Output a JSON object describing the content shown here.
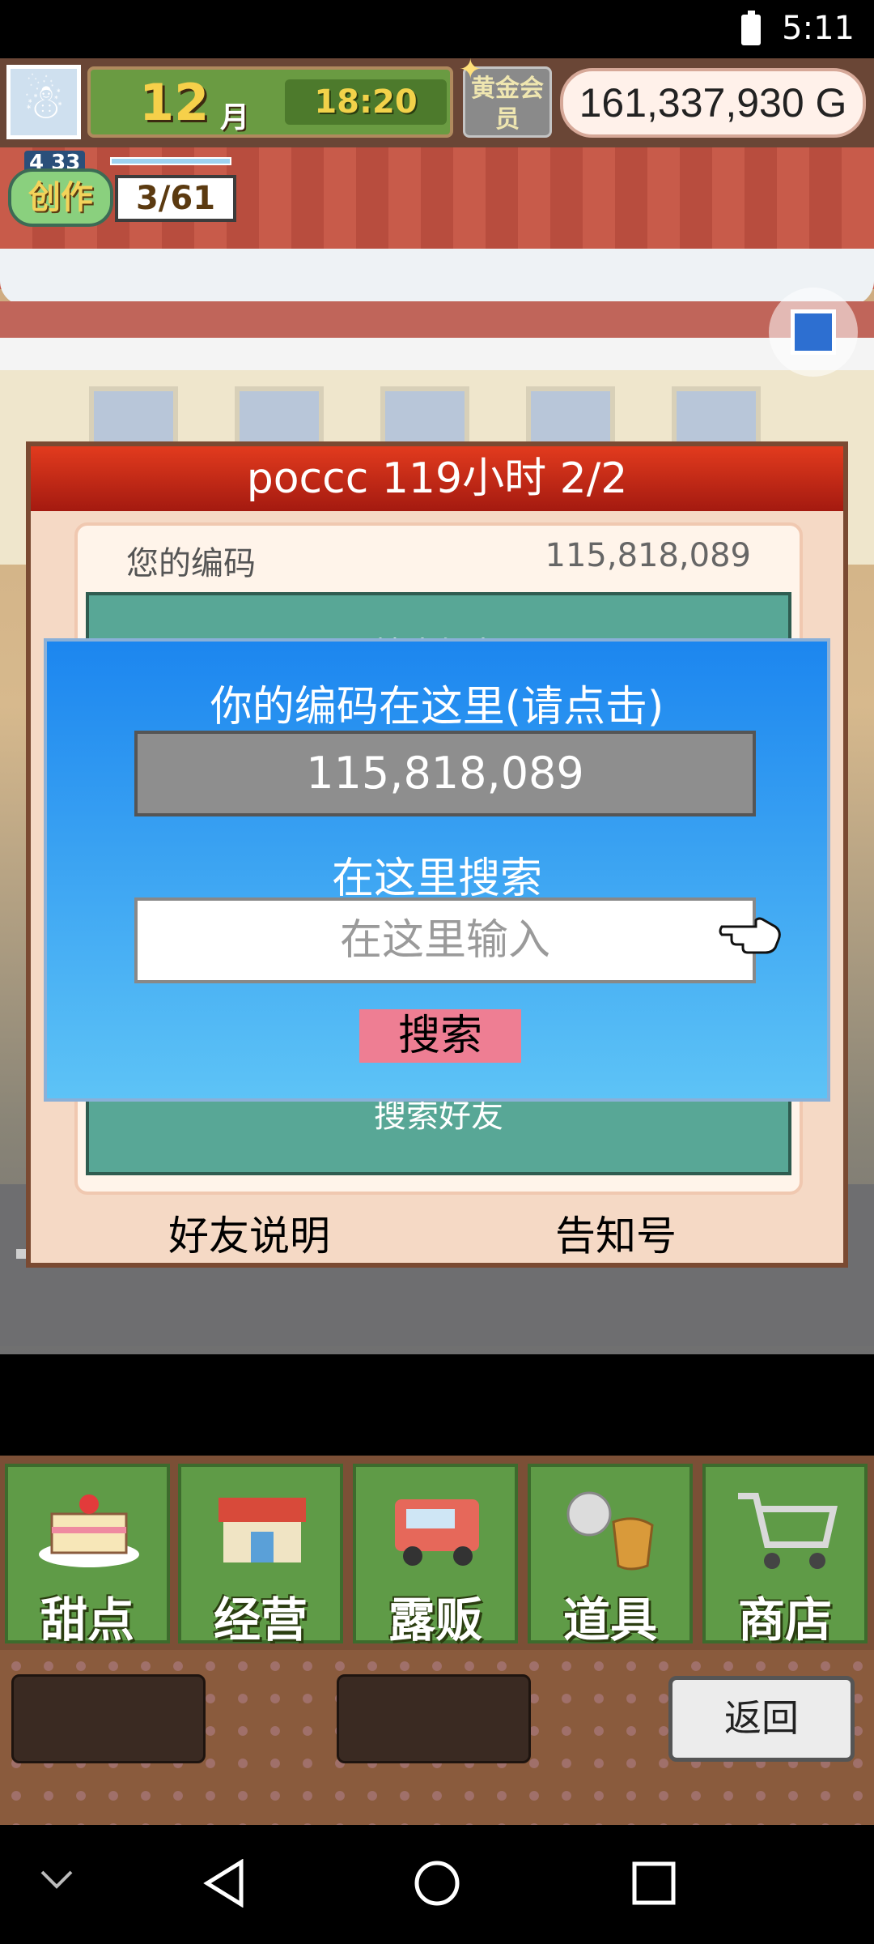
{
  "status_bar": {
    "time": "5:11"
  },
  "hud": {
    "month_number": "12",
    "month_unit": "月",
    "time": "18:20",
    "member_badge": "黄金会员",
    "money": "161,337,930 G"
  },
  "creation": {
    "level": "4 33",
    "label": "创作",
    "count": "3/61"
  },
  "friend_panel": {
    "title": "poccc  119小时 2/2",
    "code_label": "您的编码",
    "code_value": "115,818,089",
    "top_button": "搜索好友",
    "bottom_button": "搜索好友",
    "footer_left": "好友说明",
    "footer_right": "告知号"
  },
  "search_dialog": {
    "title": "你的编码在这里(请点击)",
    "code": "115,818,089",
    "subtitle": "在这里搜索",
    "input_placeholder": "在这里输入",
    "search_button": "搜索"
  },
  "menu": {
    "items": [
      {
        "label": "甜点",
        "icon": "cake-icon"
      },
      {
        "label": "经营",
        "icon": "shop-icon"
      },
      {
        "label": "露贩",
        "icon": "food-truck-icon"
      },
      {
        "label": "道具",
        "icon": "item-bag-icon"
      },
      {
        "label": "商店",
        "icon": "shopping-cart-icon"
      }
    ],
    "back_button": "返回"
  },
  "colors": {
    "dialog_blue": "#1c86ef",
    "panel_title_red": "#d42a16",
    "menu_green": "#5f9b47",
    "search_button_pink": "#ee7e93"
  }
}
